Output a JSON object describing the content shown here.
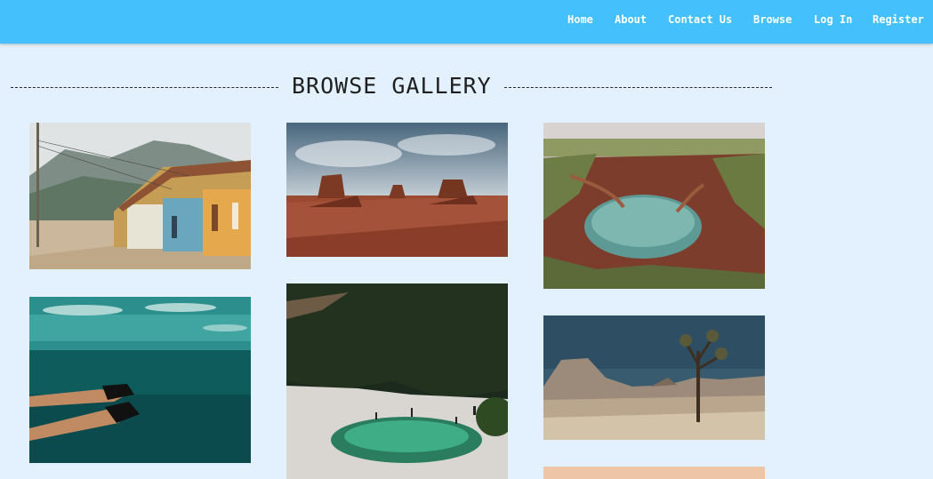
{
  "nav": {
    "items": [
      {
        "label": "Home"
      },
      {
        "label": "About"
      },
      {
        "label": "Contact Us"
      },
      {
        "label": "Browse"
      },
      {
        "label": "Log In"
      },
      {
        "label": "Register"
      }
    ]
  },
  "gallery": {
    "title": "BROWSE GALLERY"
  },
  "colors": {
    "navbar": "#44c1fd",
    "page_background": "#e2f1fd"
  }
}
